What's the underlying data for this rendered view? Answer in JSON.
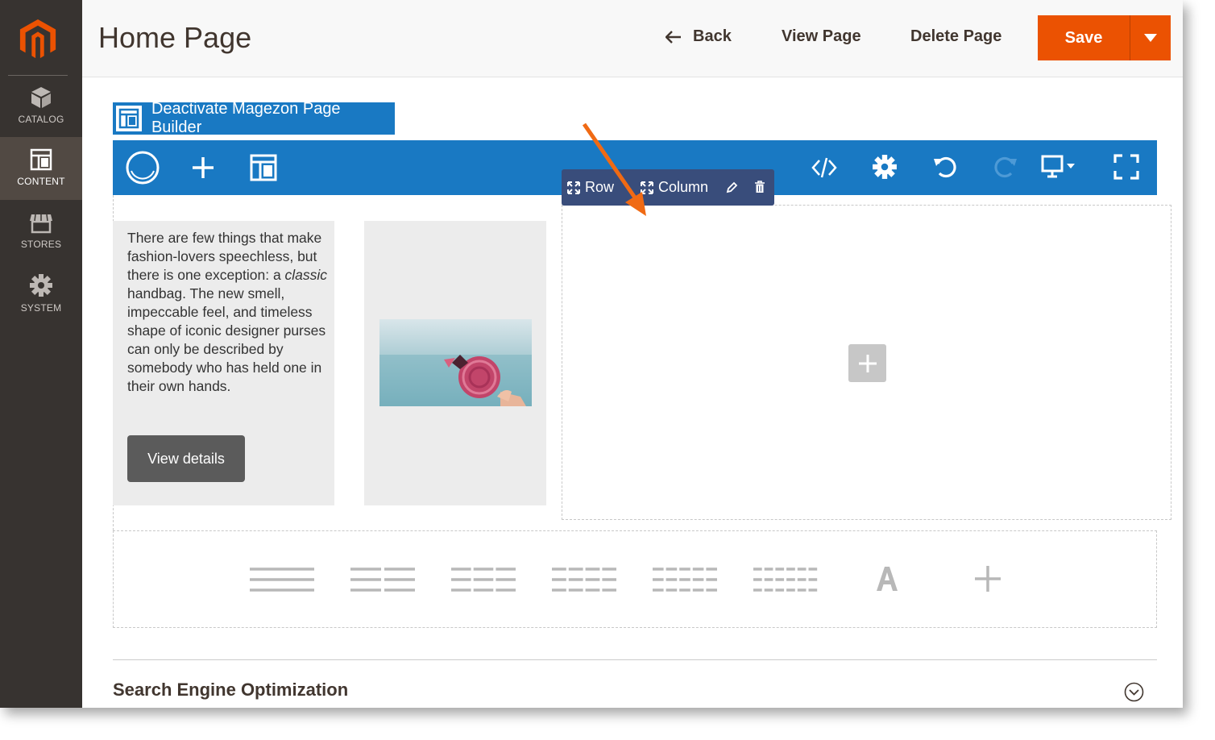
{
  "sidebar": {
    "items": [
      {
        "label": "CATALOG",
        "icon": "box-icon"
      },
      {
        "label": "CONTENT",
        "icon": "layout-icon",
        "active": true
      },
      {
        "label": "STORES",
        "icon": "store-icon"
      },
      {
        "label": "SYSTEM",
        "icon": "gear-icon"
      }
    ]
  },
  "header": {
    "title": "Home Page",
    "back_label": "Back",
    "view_label": "View Page",
    "delete_label": "Delete Page",
    "save_label": "Save"
  },
  "builder": {
    "deactivate_label": "Deactivate Magezon Page Builder",
    "row_label": "Row",
    "column_label": "Column"
  },
  "content": {
    "text_before": "There are few things that make fashion-lovers speechless, but there is one exception: a ",
    "text_italic": "classic",
    "text_after": " handbag. The new smell, impeccable feel, and timeless shape of iconic designer purses can only be described by somebody who has held one in their own hands.",
    "button_label": "View details"
  },
  "seo": {
    "title": "Search Engine Optimization"
  },
  "colors": {
    "accent": "#eb5202",
    "builder_blue": "#1979c3",
    "sidebar": "#373330",
    "row_tag": "#394d7b"
  }
}
